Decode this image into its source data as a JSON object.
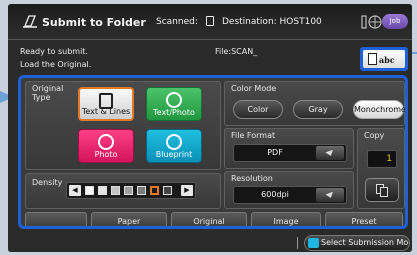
{
  "header": {
    "title": "Submit to Folder",
    "scanned_label": "Scanned:",
    "destination": "Destination: HOST100",
    "job_label": "Job"
  },
  "status": {
    "line1": "Ready to submit.",
    "line2": "Load the Original.",
    "file_name": "File:SCAN_",
    "file_format_icon_label": "abc"
  },
  "original_type": {
    "label": "Original Type",
    "options": [
      {
        "label": "Text & Lines",
        "selected": true,
        "icon": "text-lines-icon"
      },
      {
        "label": "Text/Photo",
        "selected": false,
        "icon": "text-photo-icon"
      },
      {
        "label": "Photo",
        "selected": false,
        "icon": "photo-icon"
      },
      {
        "label": "Blueprint",
        "selected": false,
        "icon": "blueprint-icon"
      }
    ]
  },
  "density": {
    "label": "Density",
    "selected_index": 5,
    "cells": 7
  },
  "color_mode": {
    "label": "Color Mode",
    "options": [
      "Color",
      "Gray",
      "Monochrome"
    ],
    "selected": "Monochrome"
  },
  "file_format": {
    "label": "File Format",
    "value": "PDF"
  },
  "resolution": {
    "label": "Resolution",
    "value": "600dpi"
  },
  "copy": {
    "label": "Copy",
    "value": "1"
  },
  "tabs": [
    "",
    "Paper",
    "Original",
    "Image",
    "Preset"
  ],
  "footer": {
    "select_mode_label": "Select Submission Mode"
  },
  "colors": {
    "accent_blue": "#1f5fd8",
    "text_photo_green": "#2fae50",
    "photo_pink": "#e8246f",
    "blueprint_cyan": "#16a8d0",
    "copy_digit": "#f3c020",
    "job_purple": "#7e5cc0"
  }
}
